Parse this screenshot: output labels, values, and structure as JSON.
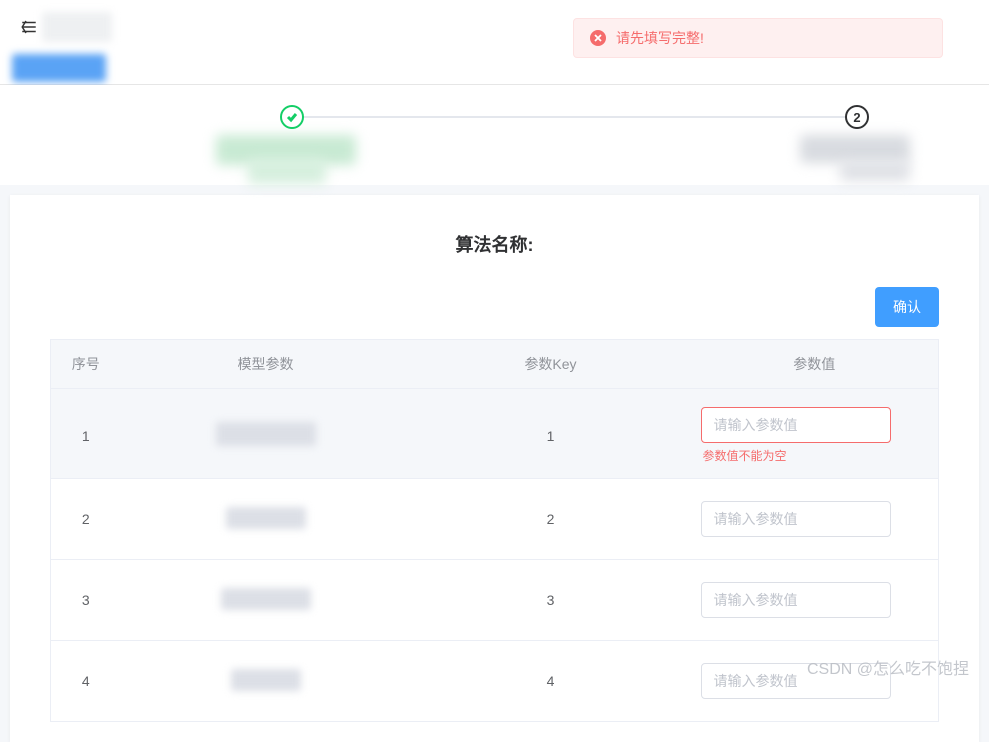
{
  "alert": {
    "text": "请先填写完整!"
  },
  "stepper": {
    "step2_number": "2"
  },
  "page": {
    "title": "算法名称:"
  },
  "actions": {
    "confirm_label": "确认"
  },
  "table": {
    "headers": {
      "index": "序号",
      "model_param": "模型参数",
      "param_key": "参数Key",
      "param_value": "参数值"
    },
    "placeholder": "请输入参数值",
    "error_empty": "参数值不能为空",
    "rows": [
      {
        "index": "1",
        "key": "1",
        "value": "",
        "invalid": true
      },
      {
        "index": "2",
        "key": "2",
        "value": "",
        "invalid": false
      },
      {
        "index": "3",
        "key": "3",
        "value": "",
        "invalid": false
      },
      {
        "index": "4",
        "key": "4",
        "value": "",
        "invalid": false
      }
    ]
  },
  "watermark": "CSDN @怎么吃不饱捏"
}
